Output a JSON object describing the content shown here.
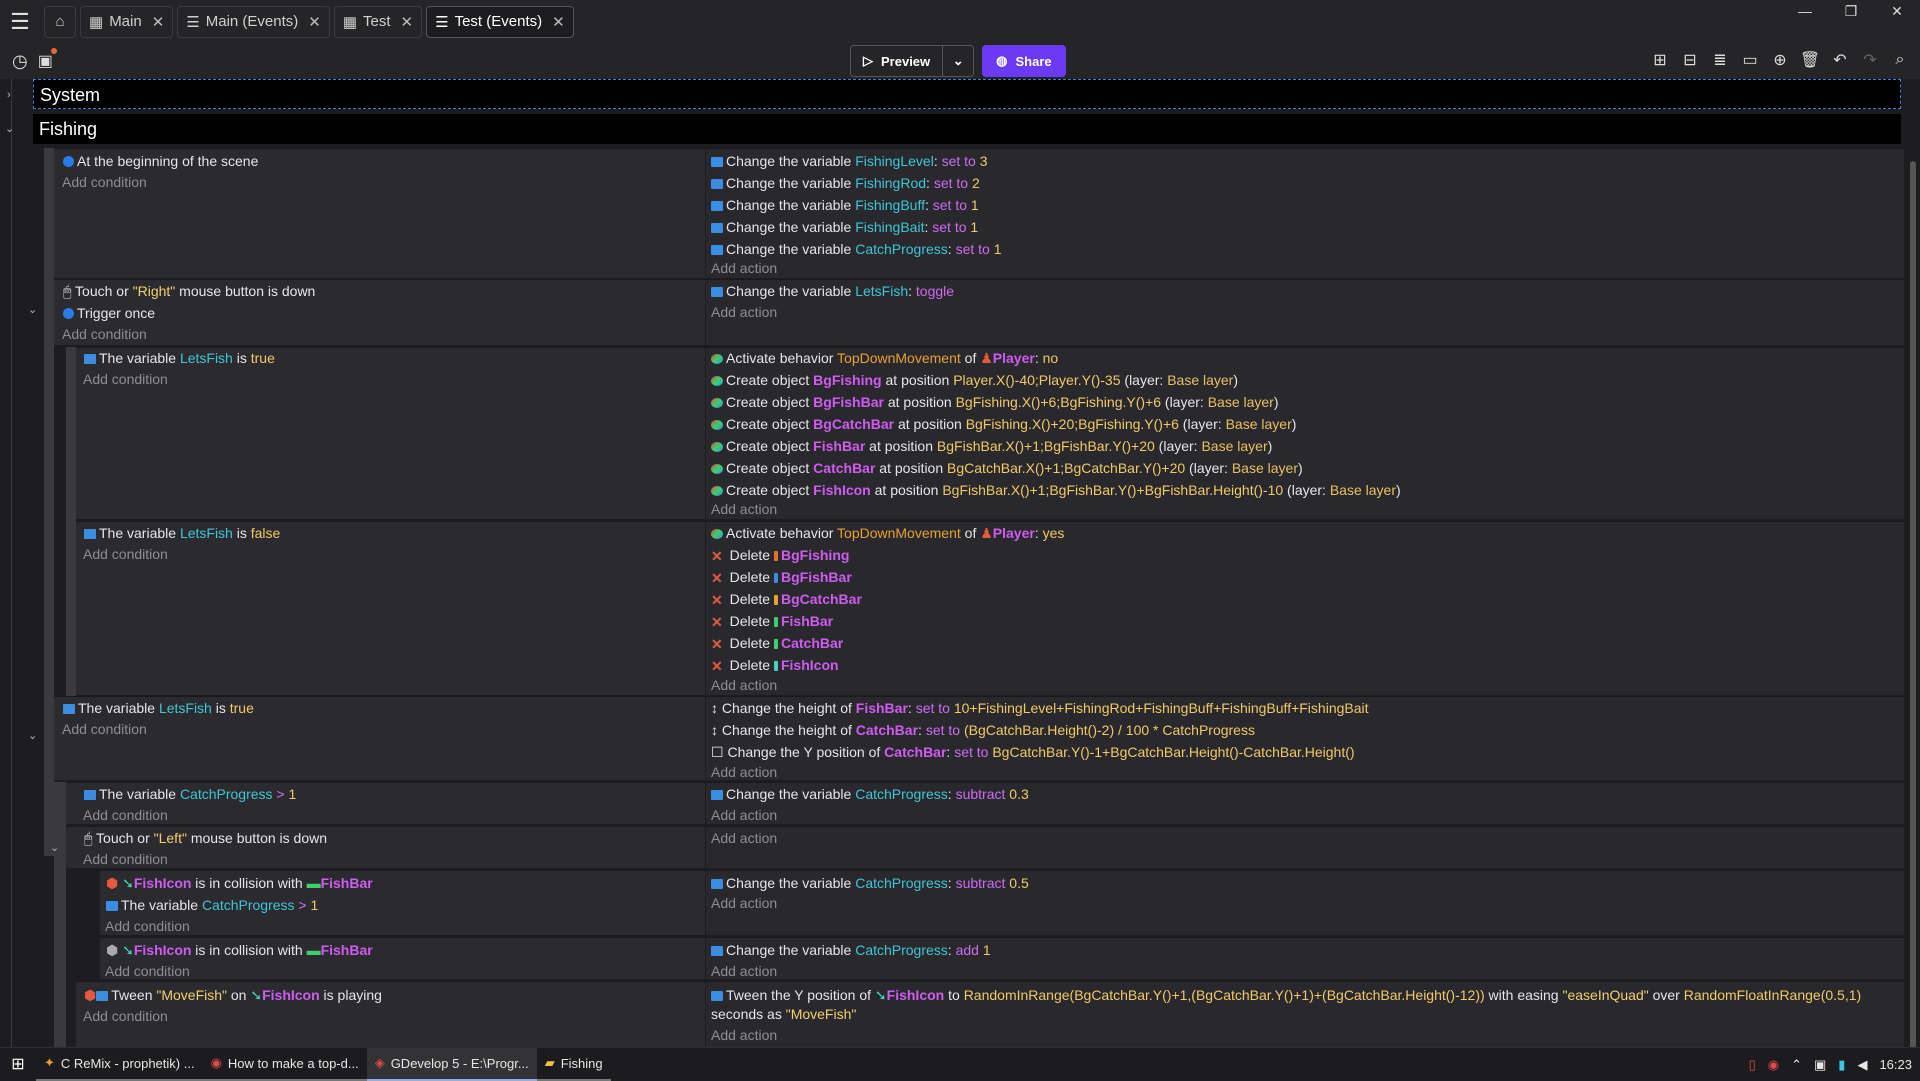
{
  "tabs": [
    {
      "label": "Main",
      "icon": "scene-icon"
    },
    {
      "label": "Main (Events)",
      "icon": "events-icon"
    },
    {
      "label": "Test",
      "icon": "scene-icon"
    },
    {
      "label": "Test (Events)",
      "icon": "events-icon",
      "active": true
    }
  ],
  "toolbar": {
    "preview_label": "Preview",
    "share_label": "Share"
  },
  "groups": {
    "system": "System",
    "fishing": "Fishing"
  },
  "ev1": {
    "conds": [
      "At the beginning of the scene"
    ],
    "actions": [
      [
        "Change the variable ",
        "FishingLevel",
        ": ",
        "set to",
        " ",
        "3"
      ],
      [
        "Change the variable ",
        "FishingRod",
        ": ",
        "set to",
        " ",
        "2"
      ],
      [
        "Change the variable ",
        "FishingBuff",
        ": ",
        "set to",
        " ",
        "1"
      ],
      [
        "Change the variable ",
        "FishingBait",
        ": ",
        "set to",
        " ",
        "1"
      ],
      [
        "Change the variable ",
        "CatchProgress",
        ": ",
        "set to",
        " ",
        "1"
      ]
    ]
  },
  "ev2": {
    "cond1": [
      "Touch or ",
      "\"Right\"",
      " mouse button is down"
    ],
    "cond2": "Trigger once",
    "action": [
      "Change the variable ",
      "LetsFish",
      ": ",
      "toggle"
    ]
  },
  "ev3": {
    "cond": [
      "The variable ",
      "LetsFish",
      " is ",
      "true"
    ],
    "act_behavior": [
      "Activate behavior ",
      "TopDownMovement",
      " of ",
      "Player",
      ": ",
      "no"
    ],
    "creates": [
      [
        "Create object ",
        "BgFishing",
        " at position ",
        "Player.X()-40;Player.Y()-35",
        " (layer: ",
        "Base layer",
        ")"
      ],
      [
        "Create object ",
        "BgFishBar",
        " at position ",
        "BgFishing.X()+6;BgFishing.Y()+6",
        " (layer: ",
        "Base layer",
        ")"
      ],
      [
        "Create object ",
        "BgCatchBar",
        " at position ",
        "BgFishing.X()+20;BgFishing.Y()+6",
        " (layer: ",
        "Base layer",
        ")"
      ],
      [
        "Create object ",
        "FishBar",
        " at position ",
        "BgFishBar.X()+1;BgFishBar.Y()+20",
        " (layer: ",
        "Base layer",
        ")"
      ],
      [
        "Create object ",
        "CatchBar",
        " at position ",
        "BgCatchBar.X()+1;BgCatchBar.Y()+20",
        " (layer: ",
        "Base layer",
        ")"
      ],
      [
        "Create object ",
        "FishIcon",
        " at position ",
        "BgFishBar.X()+1;BgFishBar.Y()+BgFishBar.Height()-10",
        " (layer: ",
        "Base layer",
        ")"
      ]
    ]
  },
  "ev4": {
    "cond": [
      "The variable ",
      "LetsFish",
      " is ",
      "false"
    ],
    "act_behavior": [
      "Activate behavior ",
      "TopDownMovement",
      " of ",
      "Player",
      ": ",
      "yes"
    ],
    "deletes": [
      "BgFishing",
      "BgFishBar",
      "BgCatchBar",
      "FishBar",
      "CatchBar",
      "FishIcon"
    ],
    "delete_label": "Delete"
  },
  "ev5": {
    "cond": [
      "The variable ",
      "LetsFish",
      " is ",
      "true"
    ],
    "actions": [
      [
        "Change the height of ",
        "FishBar",
        ": ",
        "set to",
        " ",
        "10+FishingLevel+FishingRod+FishingBuff+FishingBuff+FishingBait"
      ],
      [
        "Change the height of ",
        "CatchBar",
        ": ",
        "set to",
        " ",
        "(BgCatchBar.Height()-2) / 100 * CatchProgress"
      ],
      [
        "Change the Y position of ",
        "CatchBar",
        ": ",
        "set to",
        " ",
        "BgCatchBar.Y()-1+BgCatchBar.Height()-CatchBar.Height()"
      ]
    ]
  },
  "ev6": {
    "cond": [
      "The variable ",
      "CatchProgress",
      " > ",
      "1"
    ],
    "action": [
      "Change the variable ",
      "CatchProgress",
      ": ",
      "subtract",
      " ",
      "0.3"
    ]
  },
  "ev7": {
    "cond": [
      "Touch or ",
      "\"Left\"",
      " mouse button is down"
    ]
  },
  "ev8": {
    "cond1": [
      "FishIcon",
      " is in collision with ",
      "FishBar"
    ],
    "cond2": [
      "The variable ",
      "CatchProgress",
      " > ",
      "1"
    ],
    "action": [
      "Change the variable ",
      "CatchProgress",
      ": ",
      "subtract",
      " ",
      "0.5"
    ]
  },
  "ev9": {
    "cond": [
      "FishIcon",
      " is in collision with ",
      "FishBar"
    ],
    "action": [
      "Change the variable ",
      "CatchProgress",
      ": ",
      "add",
      " ",
      "1"
    ]
  },
  "ev10": {
    "cond": [
      "Tween ",
      "\"MoveFish\"",
      " on ",
      "FishIcon",
      " is playing"
    ],
    "action1": [
      "Tween the Y position of ",
      "FishIcon",
      " to ",
      "RandomInRange(BgCatchBar.Y()+1,(BgCatchBar.Y()+1)+(BgCatchBar.Height()-12))",
      " with easing ",
      "\"easeInQuad\"",
      " over ",
      "RandomFloatInRange(0.5,1)"
    ],
    "action2": [
      "seconds as ",
      "\"MoveFish\""
    ]
  },
  "add_condition": "Add condition",
  "add_action": "Add action",
  "taskbar": [
    "C ReMix - prophetik) ...",
    "How to make a top-d...",
    "GDevelop 5 - E:\\Progr...",
    "Fishing"
  ],
  "clock": "16:23"
}
